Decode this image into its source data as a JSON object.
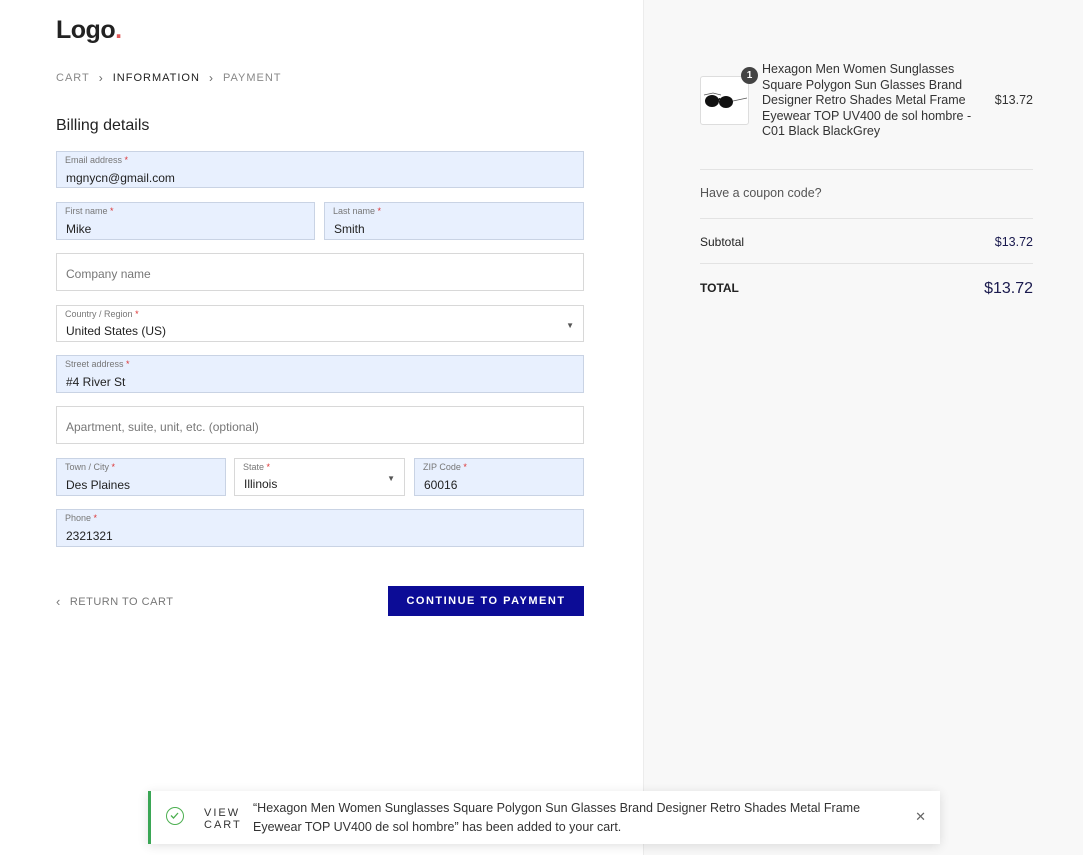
{
  "logo": {
    "text": "Logo",
    "dot": "."
  },
  "breadcrumb": {
    "cart": "CART",
    "information": "INFORMATION",
    "payment": "PAYMENT",
    "separator": ">"
  },
  "billing": {
    "title": "Billing details",
    "email": {
      "label": "Email address",
      "value": "mgnycn@gmail.com"
    },
    "first_name": {
      "label": "First name",
      "value": "Mike"
    },
    "last_name": {
      "label": "Last name",
      "value": "Smith"
    },
    "company": {
      "placeholder": "Company name"
    },
    "country": {
      "label": "Country / Region",
      "value": "United States (US)"
    },
    "street": {
      "label": "Street address",
      "value": "#4 River St"
    },
    "apartment": {
      "placeholder": "Apartment, suite, unit, etc. (optional)"
    },
    "city": {
      "label": "Town / City",
      "value": "Des Plaines"
    },
    "state": {
      "label": "State",
      "value": "Illinois"
    },
    "zip": {
      "label": "ZIP Code",
      "value": "60016"
    },
    "phone": {
      "label": "Phone",
      "value": "2321321"
    },
    "required_mark": "*"
  },
  "actions": {
    "return_label": "RETURN TO CART",
    "continue_label": "CONTINUE TO PAYMENT"
  },
  "summary": {
    "product": {
      "name": "Hexagon Men Women Sunglasses Square Polygon Sun Glasses Brand Designer Retro Shades Metal Frame Eyewear TOP UV400 de sol hombre - C01 Black BlackGrey",
      "price": "$13.72",
      "quantity": "1"
    },
    "coupon_label": "Have a coupon code?",
    "subtotal_label": "Subtotal",
    "subtotal_value": "$13.72",
    "total_label": "TOTAL",
    "total_value": "$13.72"
  },
  "toast": {
    "view_cart": "VIEW CART",
    "message": "“Hexagon Men Women Sunglasses Square Polygon Sun Glasses Brand Designer Retro Shades Metal Frame Eyewear TOP UV400 de sol hombre” has been added to your cart."
  },
  "colors": {
    "accent": "#0c0c96",
    "success": "#3aa655",
    "autofill": "#e8f0fe"
  }
}
